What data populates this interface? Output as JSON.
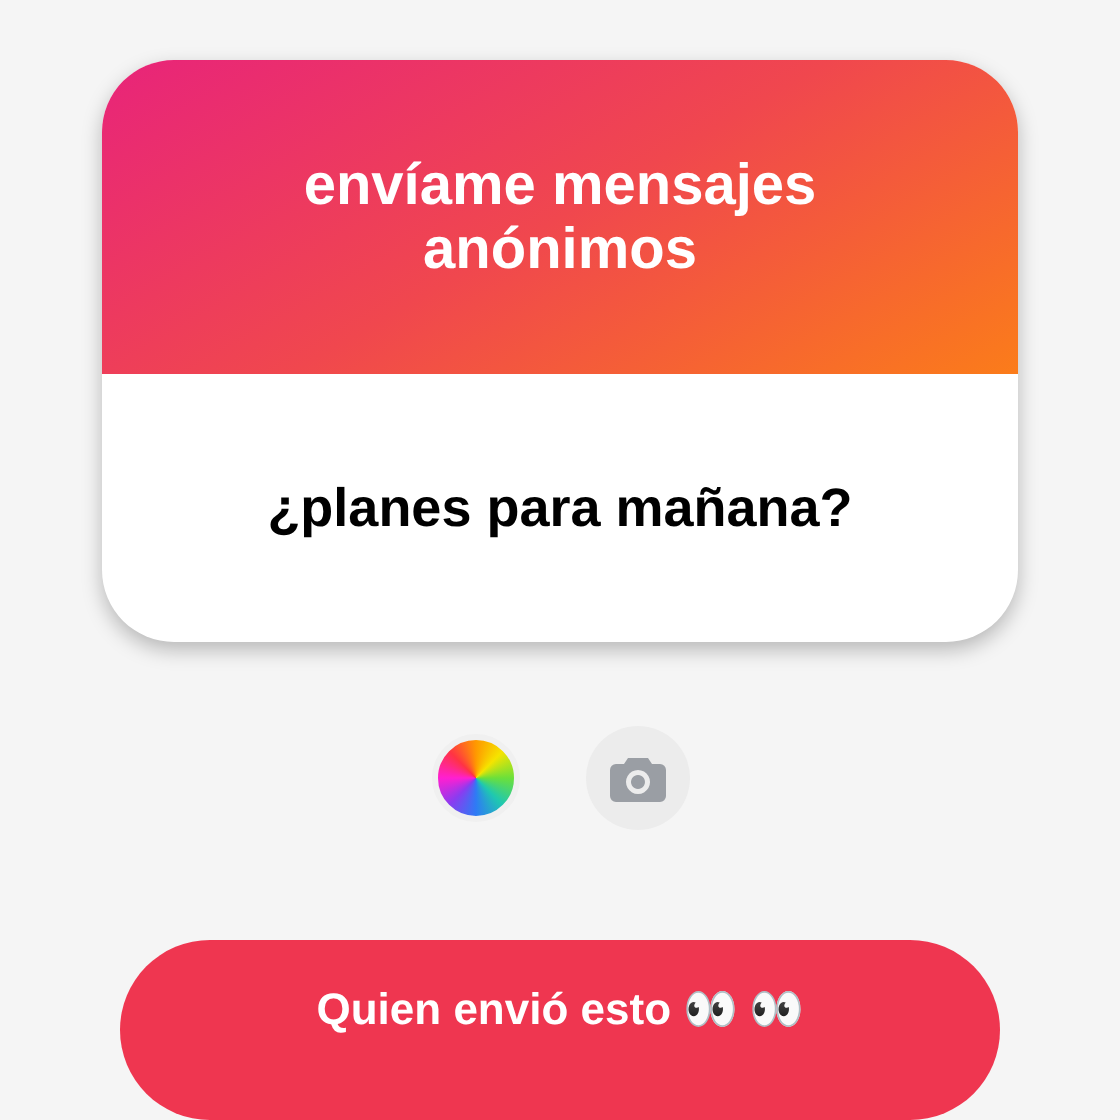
{
  "card": {
    "title": "envíame mensajes anónimos",
    "question": "¿planes para mañana?"
  },
  "button": {
    "label": "Quien envió esto 👀 👀"
  }
}
